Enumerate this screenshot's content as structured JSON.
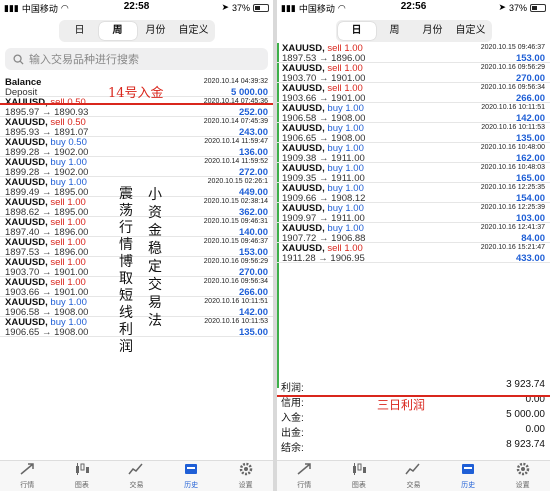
{
  "status": {
    "carrier": "中国移动",
    "battery": "37%",
    "left_time": "22:58",
    "right_time": "22:56"
  },
  "segments": [
    "日",
    "周",
    "月份",
    "自定义"
  ],
  "segment_left_active": "周",
  "segment_right_active": "日",
  "search_placeholder": "输入交易品种进行搜索",
  "left_rows": [
    {
      "kind": "balance",
      "symbol": "Balance",
      "date": "2020.10.14 04:39:32",
      "line2": "Deposit",
      "pnl": "5 000.00"
    },
    {
      "symbol": "XAUUSD,",
      "side": "sell",
      "lots": "0.50",
      "date": "2020.10.14 07:45:36",
      "from": "1895.97",
      "to": "1890.93",
      "pnl": "252.00"
    },
    {
      "symbol": "XAUUSD,",
      "side": "sell",
      "lots": "0.50",
      "date": "2020.10.14 07:45:39",
      "from": "1895.93",
      "to": "1891.07",
      "pnl": "243.00"
    },
    {
      "symbol": "XAUUSD,",
      "side": "buy",
      "lots": "0.50",
      "date": "2020.10.14 11:59:47",
      "from": "1899.28",
      "to": "1902.00",
      "pnl": "136.00"
    },
    {
      "symbol": "XAUUSD,",
      "side": "buy",
      "lots": "1.00",
      "date": "2020.10.14 11:59:52",
      "from": "1899.28",
      "to": "1902.00",
      "pnl": "272.00"
    },
    {
      "symbol": "XAUUSD,",
      "side": "buy",
      "lots": "1.00",
      "date": "2020.10.15 02:26:1",
      "from": "1899.49",
      "to": "1895.00",
      "pnl": "449.00"
    },
    {
      "symbol": "XAUUSD,",
      "side": "sell",
      "lots": "1.00",
      "date": "2020.10.15 02:38:14",
      "from": "1898.62",
      "to": "1895.00",
      "pnl": "362.00"
    },
    {
      "symbol": "XAUUSD,",
      "side": "sell",
      "lots": "1.00",
      "date": "2020.10.15 09:46:31",
      "from": "1897.40",
      "to": "1896.00",
      "pnl": "140.00"
    },
    {
      "symbol": "XAUUSD,",
      "side": "sell",
      "lots": "1.00",
      "date": "2020.10.15 09:46:37",
      "from": "1897.53",
      "to": "1896.00",
      "pnl": "153.00"
    },
    {
      "symbol": "XAUUSD,",
      "side": "sell",
      "lots": "1.00",
      "date": "2020.10.16 09:56:29",
      "from": "1903.70",
      "to": "1901.00",
      "pnl": "270.00"
    },
    {
      "symbol": "XAUUSD,",
      "side": "sell",
      "lots": "1.00",
      "date": "2020.10.16 09:56:34",
      "from": "1903.66",
      "to": "1901.00",
      "pnl": "266.00"
    },
    {
      "symbol": "XAUUSD,",
      "side": "buy",
      "lots": "1.00",
      "date": "2020.10.16 10:11:51",
      "from": "1906.58",
      "to": "1908.00",
      "pnl": "142.00"
    },
    {
      "symbol": "XAUUSD,",
      "side": "buy",
      "lots": "1.00",
      "date": "2020.10.16 10:11:53",
      "from": "1906.65",
      "to": "1908.00",
      "pnl": "135.00"
    }
  ],
  "right_rows": [
    {
      "symbol": "XAUUSD,",
      "side": "sell",
      "lots": "1.00",
      "date": "2020.10.15 09:46:37",
      "from": "1897.53",
      "to": "1896.00",
      "pnl": "153.00"
    },
    {
      "symbol": "XAUUSD,",
      "side": "sell",
      "lots": "1.00",
      "date": "2020.10.16 09:56:29",
      "from": "1903.70",
      "to": "1901.00",
      "pnl": "270.00"
    },
    {
      "symbol": "XAUUSD,",
      "side": "sell",
      "lots": "1.00",
      "date": "2020.10.16 09:56:34",
      "from": "1903.66",
      "to": "1901.00",
      "pnl": "266.00"
    },
    {
      "symbol": "XAUUSD,",
      "side": "buy",
      "lots": "1.00",
      "date": "2020.10.16 10:11:51",
      "from": "1906.58",
      "to": "1908.00",
      "pnl": "142.00"
    },
    {
      "symbol": "XAUUSD,",
      "side": "buy",
      "lots": "1.00",
      "date": "2020.10.16 10:11:53",
      "from": "1906.65",
      "to": "1908.00",
      "pnl": "135.00"
    },
    {
      "symbol": "XAUUSD,",
      "side": "buy",
      "lots": "1.00",
      "date": "2020.10.16 10:48:00",
      "from": "1909.38",
      "to": "1911.00",
      "pnl": "162.00"
    },
    {
      "symbol": "XAUUSD,",
      "side": "buy",
      "lots": "1.00",
      "date": "2020.10.16 10:48:03",
      "from": "1909.35",
      "to": "1911.00",
      "pnl": "165.00"
    },
    {
      "symbol": "XAUUSD,",
      "side": "buy",
      "lots": "1.00",
      "date": "2020.10.16 12:25:35",
      "from": "1909.66",
      "to": "1908.12",
      "pnl": "154.00"
    },
    {
      "symbol": "XAUUSD,",
      "side": "buy",
      "lots": "1.00",
      "date": "2020.10.16 12:25:39",
      "from": "1909.97",
      "to": "1911.00",
      "pnl": "103.00"
    },
    {
      "symbol": "XAUUSD,",
      "side": "buy",
      "lots": "1.00",
      "date": "2020.10.16 12:41:37",
      "from": "1907.72",
      "to": "1906.88",
      "pnl": "84.00"
    },
    {
      "symbol": "XAUUSD,",
      "side": "sell",
      "lots": "1.00",
      "date": "2020.10.16 15:21:47",
      "from": "1911.28",
      "to": "1906.95",
      "pnl": "433.00"
    }
  ],
  "summary": [
    {
      "label": "利润:",
      "value": "3 923.74"
    },
    {
      "label": "信用:",
      "value": "0.00"
    },
    {
      "label": "入金:",
      "value": "5 000.00"
    },
    {
      "label": "出金:",
      "value": "0.00"
    },
    {
      "label": "结余:",
      "value": "8 923.74"
    }
  ],
  "tabs": [
    {
      "label": "行情",
      "icon": "quotes-icon"
    },
    {
      "label": "图表",
      "icon": "chart-icon"
    },
    {
      "label": "交易",
      "icon": "trade-icon"
    },
    {
      "label": "历史",
      "icon": "history-icon",
      "active": true
    },
    {
      "label": "设置",
      "icon": "settings-icon"
    }
  ],
  "annotations": {
    "deposit_note": "14号入金",
    "col1": "小资金稳定交易法",
    "col2": "震荡行情博取短线利润",
    "profit_note": "三日利润"
  },
  "colors": {
    "buy": "#1f5fd6",
    "sell": "#d9261c",
    "accent": "#1f5fd6",
    "annotation_red": "#d9261c",
    "divider_green": "#3fb04a"
  }
}
